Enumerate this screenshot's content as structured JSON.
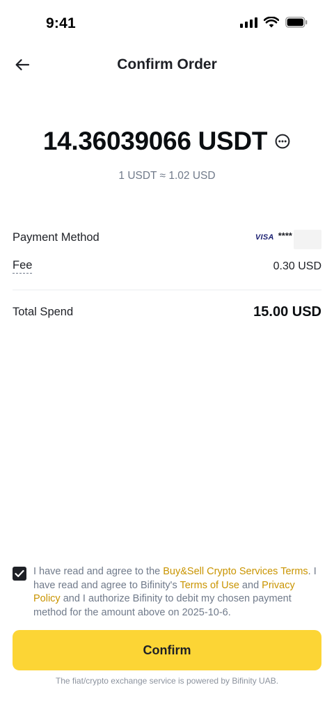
{
  "status_bar": {
    "time": "9:41"
  },
  "header": {
    "title": "Confirm Order"
  },
  "order": {
    "amount": "14.36039066 USDT",
    "rate": "1 USDT ≈ 1.02 USD"
  },
  "details": {
    "payment_method_label": "Payment Method",
    "card_brand": "VISA",
    "card_masked": "****",
    "fee_label": "Fee",
    "fee_value": "0.30 USD",
    "total_label": "Total Spend",
    "total_value": "15.00 USD"
  },
  "agreement": {
    "checked": true,
    "text_1": "I have read and agree to the ",
    "link_1": "Buy&Sell Crypto Services Terms",
    "text_2": ". I have read and agree to Bifinity's ",
    "link_2": "Terms of Use",
    "text_3": " and ",
    "link_3": "Privacy Policy",
    "text_4": " and I authorize Bifinity to debit my chosen payment method for the amount above on 2025-10-6."
  },
  "confirm_label": "Confirm",
  "footer_note": "The fiat/crypto exchange service is powered by Bifinity UAB.",
  "colors": {
    "accent": "#fcd535",
    "link": "#c99400",
    "text": "#1e2026",
    "muted": "#707a8a"
  }
}
